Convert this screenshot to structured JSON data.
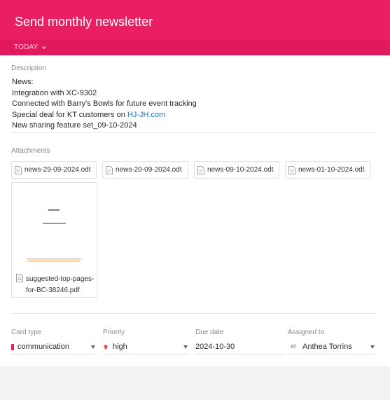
{
  "header": {
    "title": "Send monthly newsletter",
    "today_label": "TODAY",
    "accent_color": "#e91e63"
  },
  "description": {
    "label": "Description",
    "lines": [
      "News:",
      "Integration with XC-9302",
      "Connected with Barry's Bowls for future event tracking",
      "Special deal for KT customers on ",
      "New sharing feature set_09-10-2024"
    ],
    "link_text": "HJ-JH.com"
  },
  "attachments": {
    "label": "Attachments",
    "files": [
      {
        "name": "news-29-09-2024.odt",
        "icon": "document-icon"
      },
      {
        "name": "news-20-09-2024.odt",
        "icon": "document-icon"
      },
      {
        "name": "news-09-10-2024.odt",
        "icon": "document-icon"
      },
      {
        "name": "news-01-10-2024.odt",
        "icon": "document-icon"
      }
    ],
    "pdf": {
      "name_line1": "suggested-top-pages-",
      "name_line2": "for-BC-38246.pdf",
      "icon": "pdf-icon"
    }
  },
  "fields": {
    "card_type": {
      "label": "Card type",
      "value": "communication",
      "color": "#e91e63"
    },
    "priority": {
      "label": "Priority",
      "value": "high",
      "color": "#e53935"
    },
    "due_date": {
      "label": "Due date",
      "value": "2024-10-30"
    },
    "assigned_to": {
      "label": "Assigned to",
      "initials": "AT",
      "value": "Anthea Torrins"
    }
  }
}
